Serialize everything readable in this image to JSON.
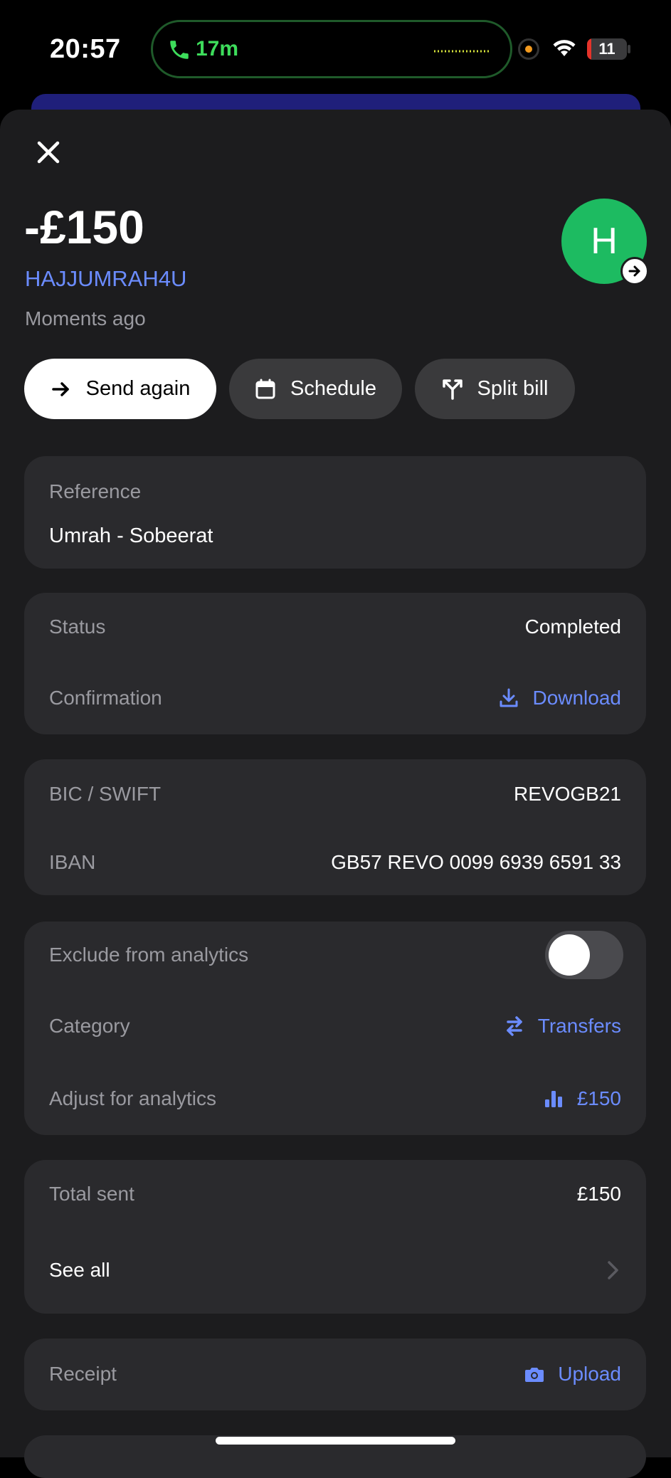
{
  "status_bar": {
    "time": "20:57",
    "call_duration": "17m",
    "battery_level": "11",
    "battery_fraction": 0.11,
    "call_color": "#3ddc5b",
    "battery_color": "#e5332a"
  },
  "transaction": {
    "amount": "-£150",
    "payee": "HAJJUMRAH4U",
    "timestamp": "Moments ago",
    "avatar_initial": "H",
    "avatar_color": "#1dbb61",
    "accent_color": "#6b8cff"
  },
  "actions": {
    "send_again": "Send again",
    "schedule": "Schedule",
    "split_bill": "Split bill"
  },
  "reference": {
    "label": "Reference",
    "value": "Umrah - Sobeerat"
  },
  "status_card": {
    "status_label": "Status",
    "status_value": "Completed",
    "confirmation_label": "Confirmation",
    "confirmation_action": "Download"
  },
  "bank_card": {
    "bic_label": "BIC / SWIFT",
    "bic_value": "REVOGB21",
    "iban_label": "IBAN",
    "iban_value": "GB57 REVO 0099 6939 6591 33"
  },
  "analytics_card": {
    "exclude_label": "Exclude from analytics",
    "exclude_enabled": false,
    "category_label": "Category",
    "category_value": "Transfers",
    "adjust_label": "Adjust for analytics",
    "adjust_value": "£150"
  },
  "totals_card": {
    "total_label": "Total sent",
    "total_value": "£150",
    "see_all": "See all"
  },
  "receipt_card": {
    "label": "Receipt",
    "action": "Upload"
  },
  "icons": {
    "close": "close-icon",
    "phone": "phone-icon",
    "wifi": "wifi-icon",
    "arrow": "arrow-right-icon",
    "calendar": "calendar-icon",
    "split": "split-icon",
    "download": "download-icon",
    "transfer": "transfer-arrows-icon",
    "chart": "bar-chart-icon",
    "chevron": "chevron-right-icon",
    "camera": "camera-icon"
  }
}
